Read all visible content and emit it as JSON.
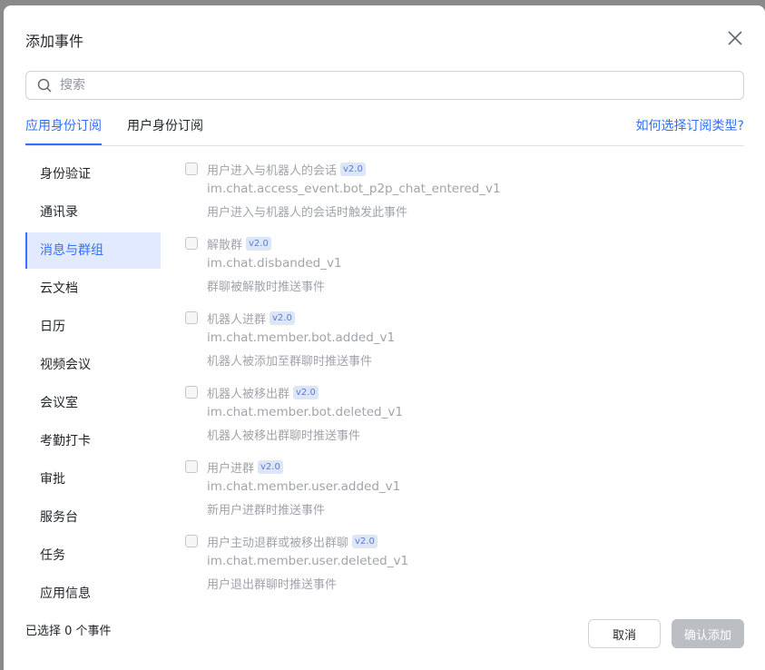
{
  "dialog": {
    "title": "添加事件",
    "close_icon": "close-icon"
  },
  "search": {
    "placeholder": "搜索",
    "value": ""
  },
  "tabs": [
    {
      "label": "应用身份订阅",
      "active": true
    },
    {
      "label": "用户身份订阅",
      "active": false
    }
  ],
  "help_link": "如何选择订阅类型?",
  "categories": [
    {
      "label": "身份验证"
    },
    {
      "label": "通讯录"
    },
    {
      "label": "消息与群组",
      "active": true
    },
    {
      "label": "云文档"
    },
    {
      "label": "日历"
    },
    {
      "label": "视频会议"
    },
    {
      "label": "会议室"
    },
    {
      "label": "考勤打卡"
    },
    {
      "label": "审批"
    },
    {
      "label": "服务台"
    },
    {
      "label": "任务"
    },
    {
      "label": "应用信息"
    }
  ],
  "events": [
    {
      "name": "用户进入与机器人的会话",
      "badge": "v2.0",
      "key": "im.chat.access_event.bot_p2p_chat_entered_v1",
      "desc": "用户进入与机器人的会话时触发此事件"
    },
    {
      "name": "解散群",
      "badge": "v2.0",
      "key": "im.chat.disbanded_v1",
      "desc": "群聊被解散时推送事件"
    },
    {
      "name": "机器人进群",
      "badge": "v2.0",
      "key": "im.chat.member.bot.added_v1",
      "desc": "机器人被添加至群聊时推送事件"
    },
    {
      "name": "机器人被移出群",
      "badge": "v2.0",
      "key": "im.chat.member.bot.deleted_v1",
      "desc": "机器人被移出群聊时推送事件"
    },
    {
      "name": "用户进群",
      "badge": "v2.0",
      "key": "im.chat.member.user.added_v1",
      "desc": "新用户进群时推送事件"
    },
    {
      "name": "用户主动退群或被移出群聊",
      "badge": "v2.0",
      "key": "im.chat.member.user.deleted_v1",
      "desc": "用户退出群聊时推送事件"
    }
  ],
  "footer": {
    "selected_count": "已选择 0 个事件",
    "cancel_label": "取消",
    "confirm_label": "确认添加"
  }
}
